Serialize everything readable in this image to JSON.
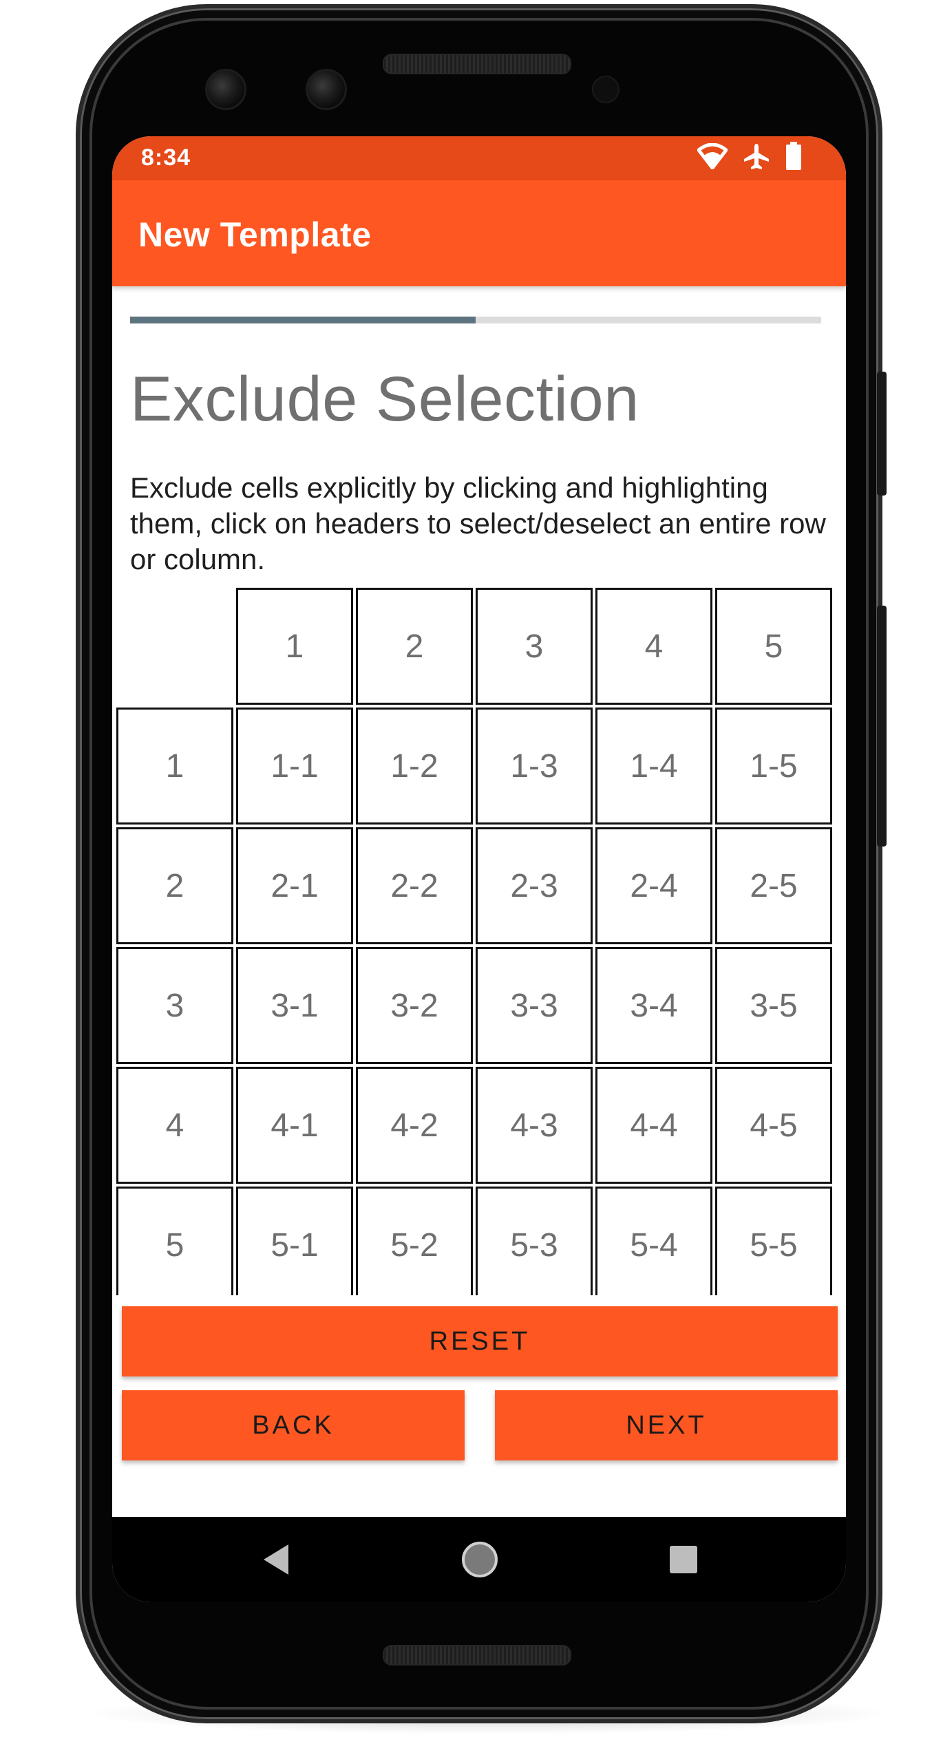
{
  "status_bar": {
    "time": "8:34",
    "icons": [
      "wifi-icon",
      "airplane-icon",
      "battery-icon"
    ],
    "background": "#e64a19"
  },
  "app_bar": {
    "title": "New Template",
    "background": "#ff5722"
  },
  "progress": {
    "fraction": 0.5,
    "fill_color": "#5d7480",
    "track_color": "#dcdcdc"
  },
  "page": {
    "heading": "Exclude Selection",
    "description": "Exclude cells explicitly by clicking and highlighting them, click on headers to select/deselect an entire row or column."
  },
  "grid": {
    "column_headers": [
      "1",
      "2",
      "3",
      "4",
      "5"
    ],
    "row_headers": [
      "1",
      "2",
      "3",
      "4",
      "5"
    ],
    "cells": [
      [
        "1-1",
        "1-2",
        "1-3",
        "1-4",
        "1-5"
      ],
      [
        "2-1",
        "2-2",
        "2-3",
        "2-4",
        "2-5"
      ],
      [
        "3-1",
        "3-2",
        "3-3",
        "3-4",
        "3-5"
      ],
      [
        "4-1",
        "4-2",
        "4-3",
        "4-4",
        "4-5"
      ],
      [
        "5-1",
        "5-2",
        "5-3",
        "5-4",
        "5-5"
      ]
    ]
  },
  "buttons": {
    "reset": "RESET",
    "back": "BACK",
    "next": "NEXT",
    "color": "#ff5722"
  },
  "nav": {
    "icons": [
      "back-triangle-icon",
      "home-circle-icon",
      "recents-square-icon"
    ]
  }
}
